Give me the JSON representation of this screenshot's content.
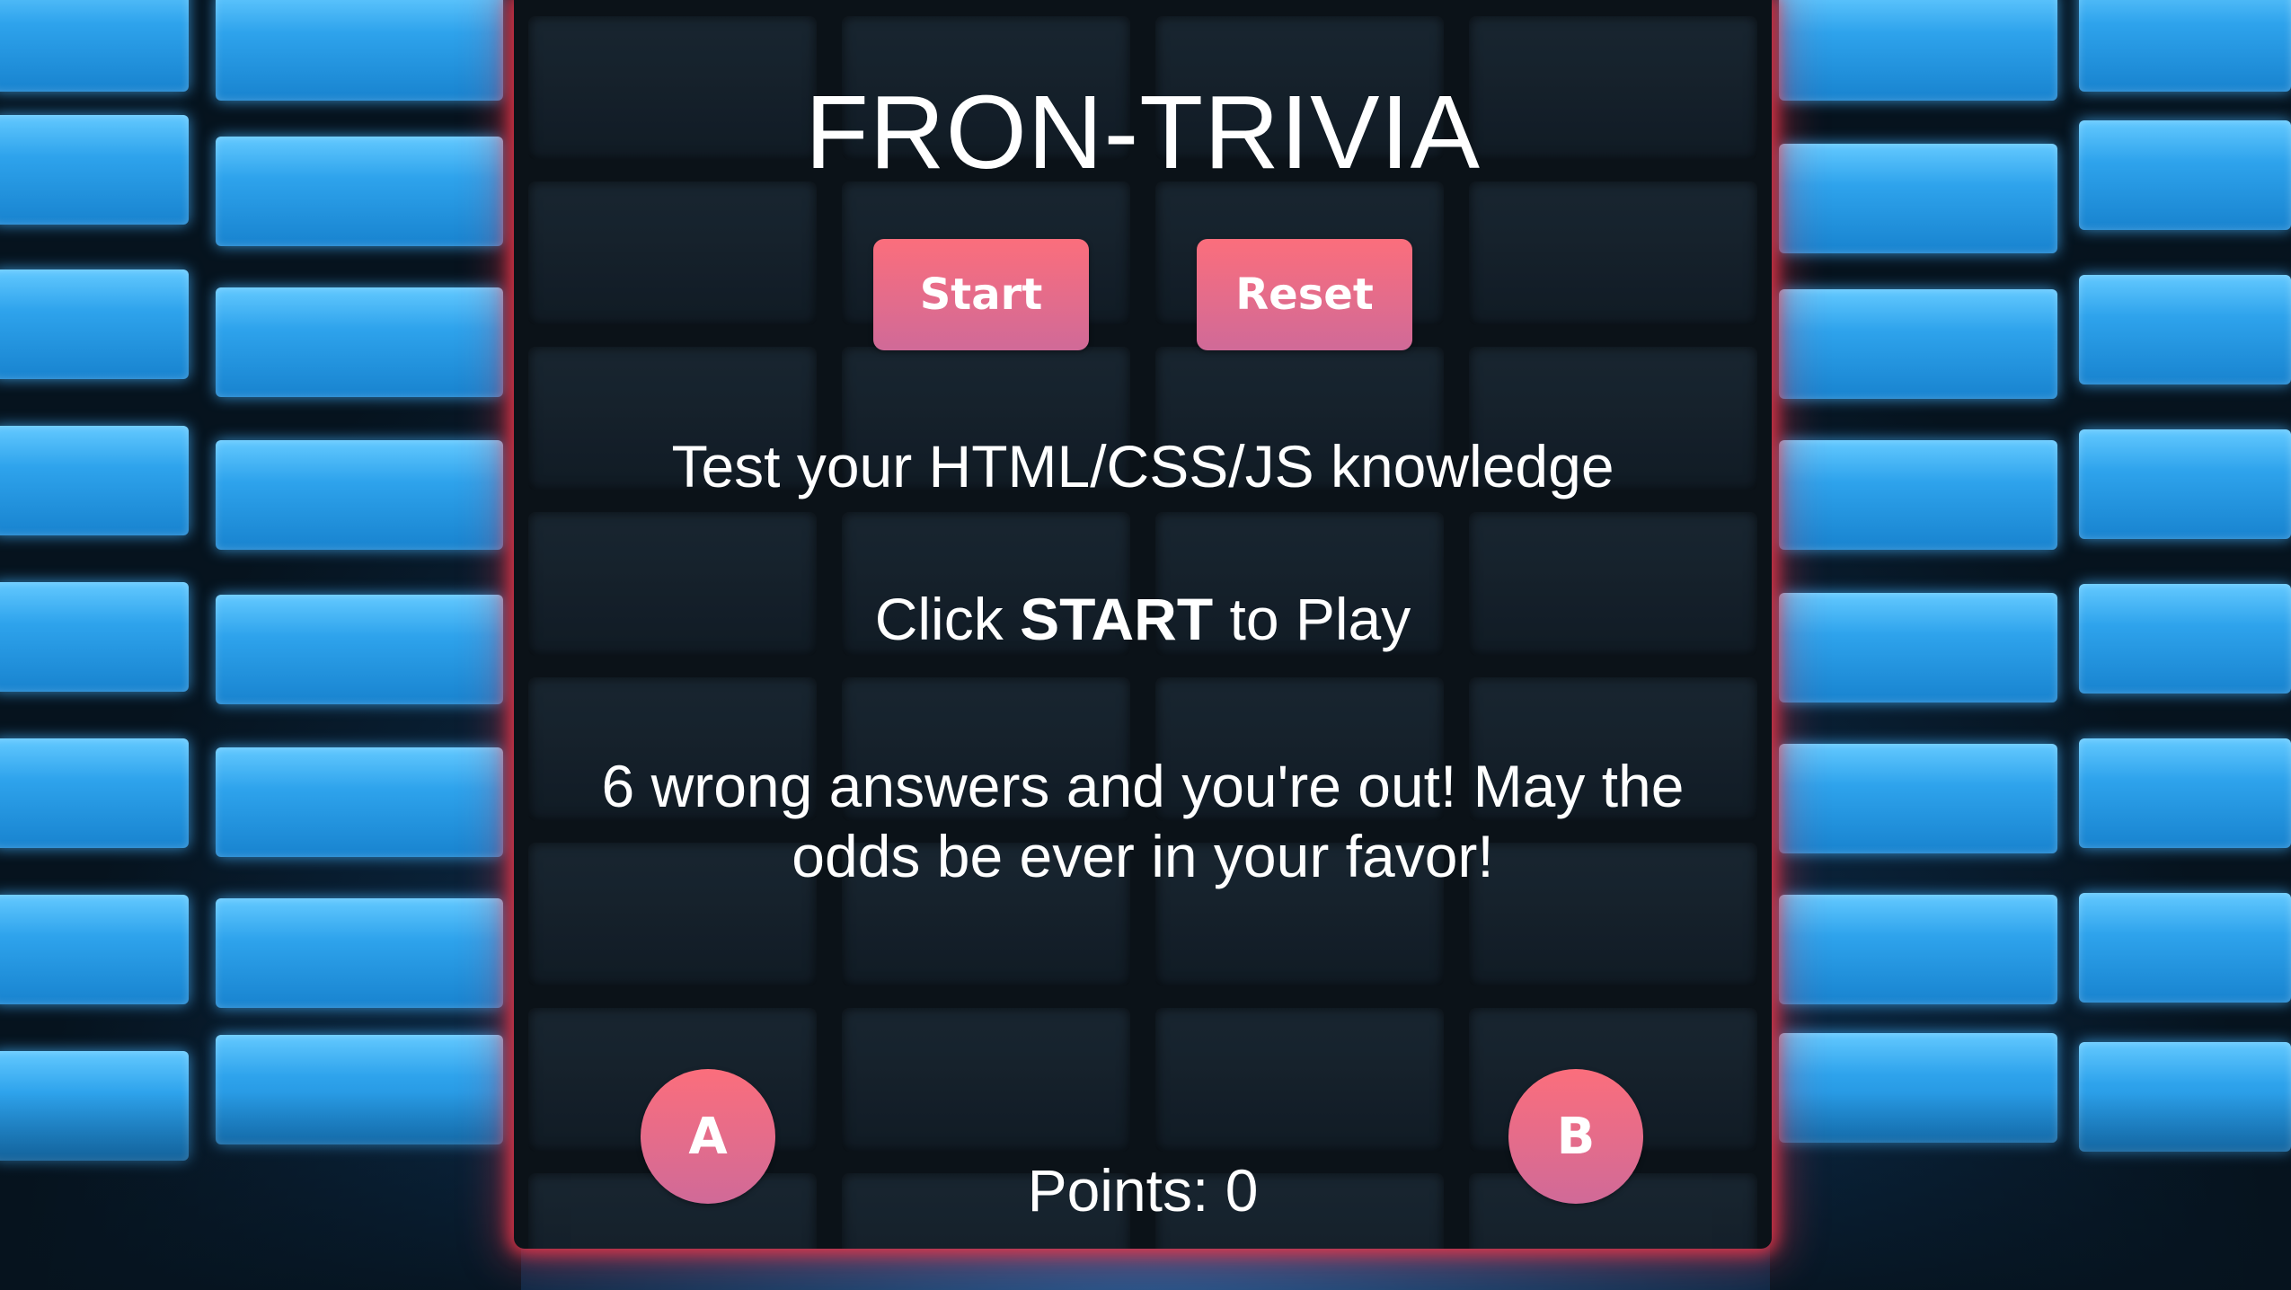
{
  "game": {
    "title": "FRON-TRIVIA",
    "buttons": {
      "start_label": "Start",
      "reset_label": "Reset"
    },
    "tagline": "Test your HTML/CSS/JS knowledge",
    "instruction": {
      "prefix": "Click ",
      "emphasis": "START",
      "suffix": " to Play"
    },
    "warning": "6 wrong answers and you're out! May the odds be ever in your favor!",
    "answers": {
      "a_label": "A",
      "b_label": "B"
    },
    "points": {
      "label": "Points: ",
      "value": "0"
    }
  },
  "colors": {
    "button_gradient_top": "#fb6e7c",
    "button_gradient_bottom": "#d06a98",
    "board_glow": "#e83448",
    "wall_tiles": "#2ea3ec",
    "board_background": "#0b1218"
  }
}
